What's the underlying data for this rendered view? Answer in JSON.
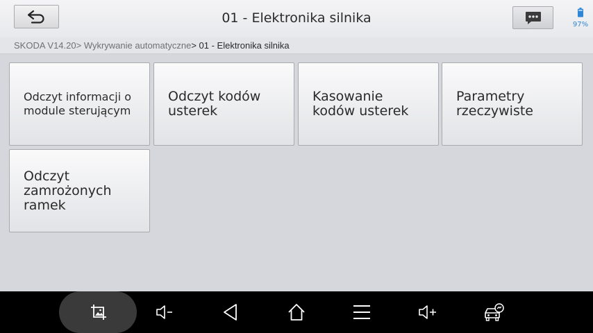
{
  "header": {
    "title": "01 - Elektronika silnika",
    "battery_percent": "97%"
  },
  "breadcrumb": {
    "path": "SKODA V14.20> Wykrywanie automatyczne",
    "current": "> 01 - Elektronika silnika"
  },
  "menu": {
    "tiles": [
      {
        "label": "Odczyt informacji o module sterującym"
      },
      {
        "label": "Odczyt kodów usterek"
      },
      {
        "label": "Kasowanie kodów usterek"
      },
      {
        "label": "Parametry rzeczywiste"
      },
      {
        "label": "Odczyt zamrożonych ramek"
      }
    ]
  },
  "navbar": {
    "icons": [
      "screenshot-icon",
      "volume-down-icon",
      "back-triangle-icon",
      "home-icon",
      "menu-icon",
      "volume-up-icon",
      "car-diagnostic-icon"
    ]
  },
  "colors": {
    "accent": "#2f86d4",
    "background": "#d6d7dc",
    "navbar": "#000000"
  }
}
